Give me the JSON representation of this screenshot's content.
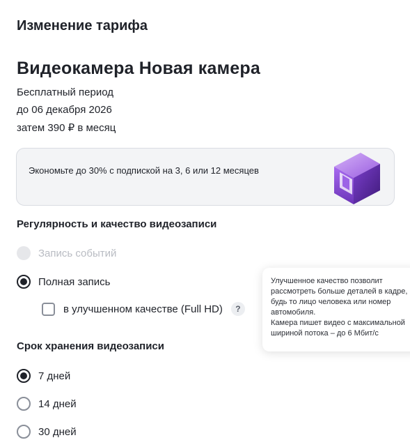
{
  "header": {
    "title": "Изменение тарифа"
  },
  "camera": {
    "name": "Видеокамера Новая камера",
    "period_lines": [
      "Бесплатный период",
      "до 06 декабря 2026",
      "затем 390 ₽ в месяц"
    ]
  },
  "promo": {
    "text": "Экономьте до 30% с подпиской на 3, 6 или 12 месяцев",
    "icon": "cube-icon",
    "colors": {
      "primary": "#8b4dd6",
      "light": "#c59af0",
      "dark": "#5c2aa3"
    }
  },
  "recording": {
    "title": "Регулярность и качество видеозаписи",
    "options": [
      {
        "label": "Запись событий",
        "state": "disabled"
      },
      {
        "label": "Полная запись",
        "state": "checked"
      }
    ],
    "hd_option": {
      "label": "в улучшенном качестве (Full HD)",
      "checked": false,
      "help_icon": "?"
    }
  },
  "tooltip": {
    "paragraph1": [
      "Улучшенное качество позволит",
      "рассмотреть больше деталей в кадре,",
      "будь то лицо человека или номер",
      "автомобиля."
    ],
    "paragraph2": [
      "Камера пишет видео с максимальной",
      "шириной потока – до 6 Мбит/с"
    ]
  },
  "storage": {
    "title": "Срок хранения видеозаписи",
    "options": [
      {
        "label": "7 дней",
        "checked": true
      },
      {
        "label": "14 дней",
        "checked": false
      },
      {
        "label": "30 дней",
        "checked": false
      }
    ]
  },
  "colors": {
    "text": "#1f2229",
    "disabled": "#b9bcc3",
    "card_bg": "#f3f4f6"
  }
}
